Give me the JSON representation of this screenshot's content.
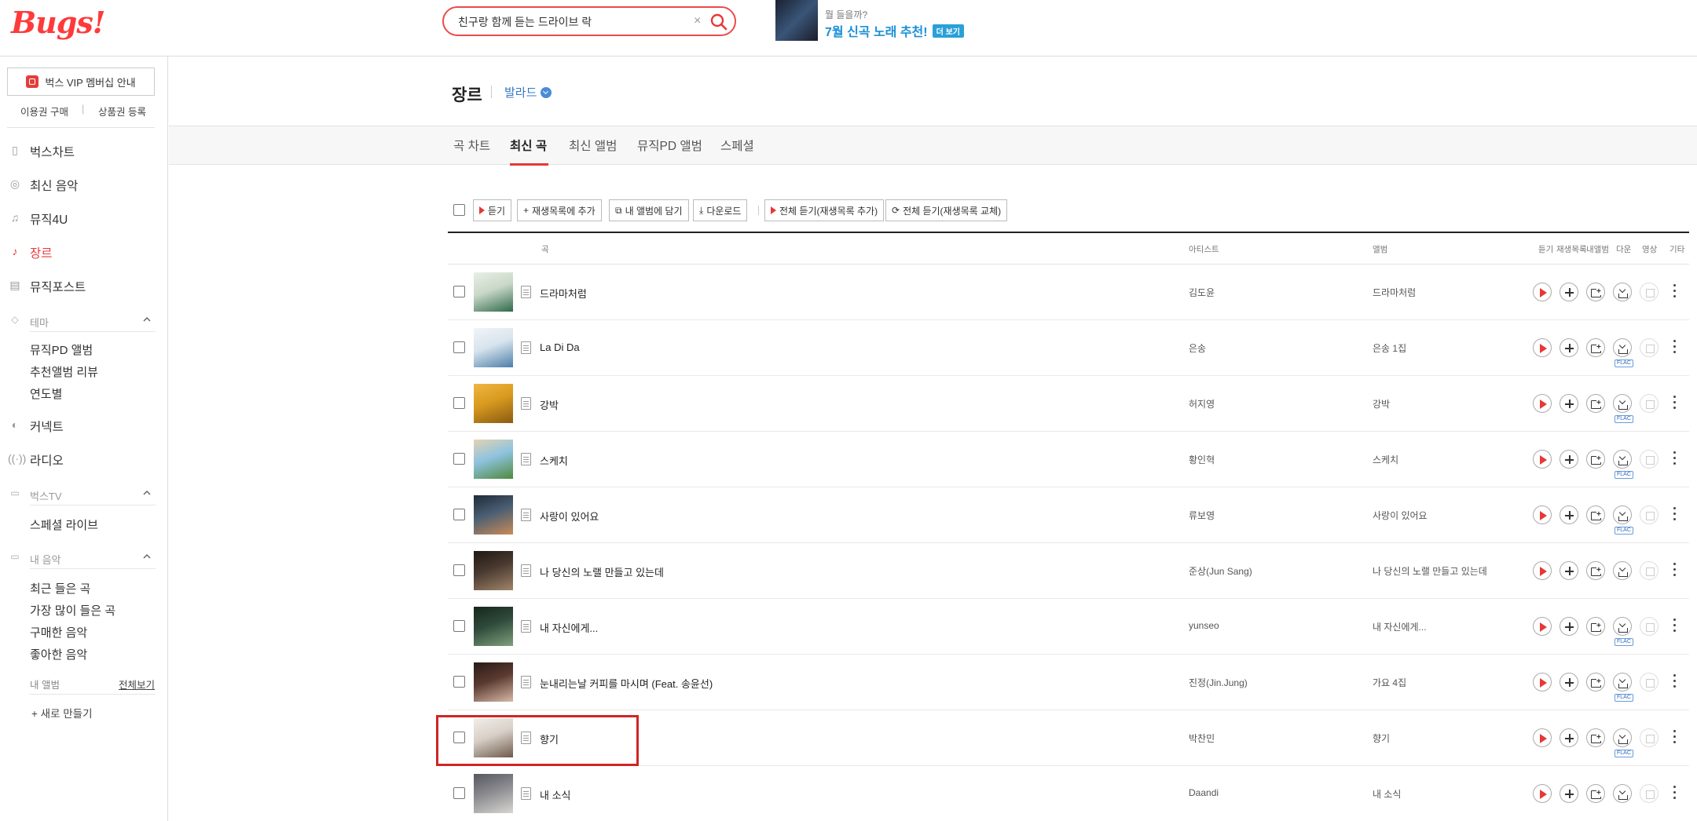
{
  "header": {
    "logo": "Bugs!",
    "search": {
      "value": "친구랑 함께 듣는 드라이브 락",
      "clear": "×"
    },
    "promo": {
      "sub": "뭘 들을까?",
      "title": "7월 신곡 노래 추천!",
      "badge": "더 보기"
    }
  },
  "sidebar": {
    "vip": "벅스 VIP 멤버십 안내",
    "links": [
      "이용권 구매",
      "상품권 등록"
    ],
    "nav": [
      {
        "label": "벅스차트",
        "icon": "chart-icon"
      },
      {
        "label": "최신 음악",
        "icon": "new-music-icon"
      },
      {
        "label": "뮤직4U",
        "icon": "music-note-icon"
      },
      {
        "label": "장르",
        "icon": "guitar-icon",
        "active": true
      },
      {
        "label": "뮤직포스트",
        "icon": "post-icon"
      }
    ],
    "theme_group": {
      "label": "테마",
      "items": [
        "뮤직PD 앨범",
        "추천앨범 리뷰",
        "연도별"
      ]
    },
    "nav2": [
      {
        "label": "커넥트",
        "icon": "connect-icon"
      },
      {
        "label": "라디오",
        "icon": "radio-icon"
      }
    ],
    "tv_group": {
      "label": "벅스TV",
      "items": [
        "스페셜 라이브"
      ]
    },
    "my_group": {
      "label": "내 음악",
      "items": [
        "최근 들은 곡",
        "가장 많이 들은 곡",
        "구매한 음악",
        "좋아한 음악"
      ]
    },
    "my_album": "내 앨범",
    "view_all": "전체보기",
    "new_make": "+  새로 만들기"
  },
  "page": {
    "title": "장르",
    "genre": "발라드",
    "tabs": [
      "곡 차트",
      "최신 곡",
      "최신 앨범",
      "뮤직PD 앨범",
      "스페셜"
    ],
    "active_tab": 1
  },
  "toolbar": {
    "listen": "듣기",
    "add_playlist": "재생목록에 추가",
    "add_album": "내 앨범에 담기",
    "download": "다운로드",
    "play_all_add": "전체 듣기(재생목록 추가)",
    "play_all_replace": "전체 듣기(재생목록 교체)"
  },
  "table": {
    "headers": {
      "song": "곡",
      "artist": "아티스트",
      "album": "앨범",
      "listen": "듣기",
      "playlist": "재생목록",
      "myalbum": "내앨범",
      "down": "다운",
      "video": "영상",
      "etc": "기타"
    },
    "flac": "FLAC",
    "rows": [
      {
        "title": "드라마처럼",
        "artist": "김도윤",
        "album": "드라마처럼",
        "flac": false,
        "thumb": [
          "#c9d8c8",
          "#2f6a4b",
          "#e9efe6"
        ]
      },
      {
        "title": "La Di Da",
        "artist": "은송",
        "album": "은송 1집",
        "flac": true,
        "thumb": [
          "#d7e4ee",
          "#4d7fa8",
          "#f1f4f7"
        ]
      },
      {
        "title": "강박",
        "artist": "허지영",
        "album": "강박",
        "flac": true,
        "thumb": [
          "#d89a1e",
          "#8a5a12",
          "#f0b644"
        ]
      },
      {
        "title": "스케치",
        "artist": "황인혁",
        "album": "스케치",
        "flac": true,
        "thumb": [
          "#8ec3e0",
          "#4f8a3e",
          "#e4d3b0"
        ]
      },
      {
        "title": "사랑이 있어요",
        "artist": "류보영",
        "album": "사랑이 있어요",
        "flac": true,
        "thumb": [
          "#4a5e73",
          "#c98b58",
          "#1f2a38"
        ]
      },
      {
        "title": "나 당신의 노랠 만들고 있는데",
        "artist": "준상(Jun Sang)",
        "album": "나 당신의 노랠 만들고 있는데",
        "flac": false,
        "thumb": [
          "#4a3a30",
          "#a0856a",
          "#1e1712"
        ]
      },
      {
        "title": "내 자신에게...",
        "artist": "yunseo",
        "album": "내 자신에게...",
        "flac": true,
        "thumb": [
          "#2f4a3a",
          "#7fa07c",
          "#16261c"
        ]
      },
      {
        "title": "눈내리는날 커피를 마시며 (Feat. 송윤선)",
        "artist": "진정(Jin.Jung)",
        "album": "가요 4집",
        "flac": true,
        "thumb": [
          "#5a3a30",
          "#d7b9a6",
          "#2a1a16"
        ]
      },
      {
        "title": "향기",
        "artist": "박찬민",
        "album": "향기",
        "flac": true,
        "thumb": [
          "#d8d0c8",
          "#6e5a4a",
          "#f2ede8"
        ]
      },
      {
        "title": "내 소식",
        "artist": "Daandi",
        "album": "내 소식",
        "flac": false,
        "thumb": [
          "#8a8a90",
          "#d8d6d0",
          "#55585e"
        ]
      }
    ]
  }
}
